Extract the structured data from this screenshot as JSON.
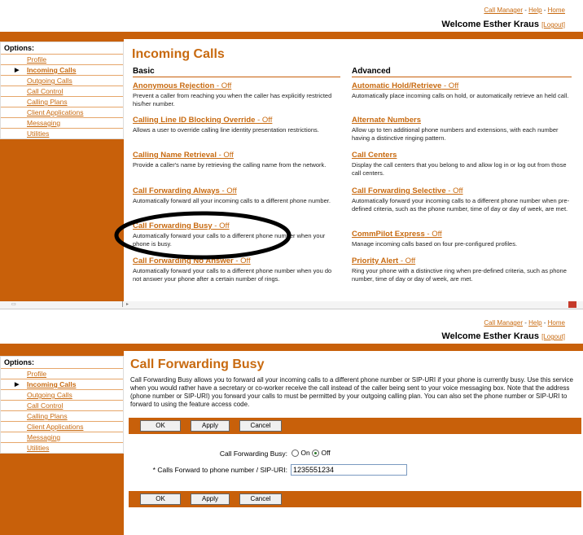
{
  "top": {
    "nav": [
      "Call Manager",
      "Help",
      "Home"
    ],
    "welcome": "Welcome Esther Kraus",
    "logout": "[Logout]"
  },
  "sidebar": {
    "title": "Options:",
    "items": [
      {
        "label": "Profile"
      },
      {
        "label": "Incoming Calls"
      },
      {
        "label": "Outgoing Calls"
      },
      {
        "label": "Call Control"
      },
      {
        "label": "Calling Plans"
      },
      {
        "label": "Client Applications"
      },
      {
        "label": "Messaging"
      },
      {
        "label": "Utilities"
      }
    ]
  },
  "incoming": {
    "title": "Incoming Calls",
    "basic_header": "Basic",
    "advanced_header": "Advanced",
    "basic": [
      {
        "name": "Anonymous Rejection",
        "state": " - Off",
        "desc": "Prevent a caller from reaching you when the caller has explicitly restricted his/her number."
      },
      {
        "name": "Calling Line ID Blocking Override",
        "state": " - Off",
        "desc": "Allows a user to override calling line identity presentation restrictions."
      },
      {
        "name": "Calling Name Retrieval",
        "state": " - Off",
        "desc": "Provide a caller's name by retrieving the calling name from the network."
      },
      {
        "name": "Call Forwarding Always",
        "state": " - Off",
        "desc": "Automatically forward all your incoming calls to a different phone number."
      },
      {
        "name": "Call Forwarding Busy",
        "state": " - Off",
        "desc": "Automatically forward your calls to a different phone number when your phone is busy."
      },
      {
        "name": "Call Forwarding No Answer",
        "state": " - Off",
        "desc": "Automatically forward your calls to a different phone number when you do not answer your phone after a certain number of rings."
      }
    ],
    "advanced": [
      {
        "name": "Automatic Hold/Retrieve",
        "state": " - Off",
        "desc": "Automatically place incoming calls on hold, or automatically retrieve an held call."
      },
      {
        "name": "Alternate Numbers",
        "state": "",
        "desc": "Allow up to ten additional phone numbers and extensions, with each number having a distinctive ringing pattern."
      },
      {
        "name": "Call Centers",
        "state": "",
        "desc": "Display the call centers that you belong to and allow log in or log out from those call centers."
      },
      {
        "name": "Call Forwarding Selective",
        "state": " - Off",
        "desc": "Automatically forward your incoming calls to a different phone number when pre-defined criteria, such as the phone number, time of day or day of week, are met."
      },
      {
        "name": "CommPilot Express",
        "state": " - Off",
        "desc": "Manage incoming calls based on four pre-configured profiles."
      },
      {
        "name": "Priority Alert",
        "state": " - Off",
        "desc": "Ring your phone with a distinctive ring when pre-defined criteria, such as phone number, time of day or day of week, are met."
      }
    ]
  },
  "cfb": {
    "title": "Call Forwarding Busy",
    "description": "Call Forwarding Busy allows you to forward all your incoming calls to a different phone number or SIP-URI if your phone is currently busy. Use this service when you would rather have a secretary or co-worker receive the call instead of the caller being sent to your voice messaging box. Note that the address (phone number or SIP-URI) you forward your calls to must be permitted by your outgoing calling plan. You can also set the phone number or SIP-URI to forward to using the feature access code.",
    "buttons": {
      "ok": "OK",
      "apply": "Apply",
      "cancel": "Cancel"
    },
    "toggle_label": "Call Forwarding Busy:",
    "on_label": "On",
    "off_label": "Off",
    "selected": "Off",
    "number_label": "* Calls Forward to phone number / SIP-URI:",
    "number_value": "1235551234"
  }
}
